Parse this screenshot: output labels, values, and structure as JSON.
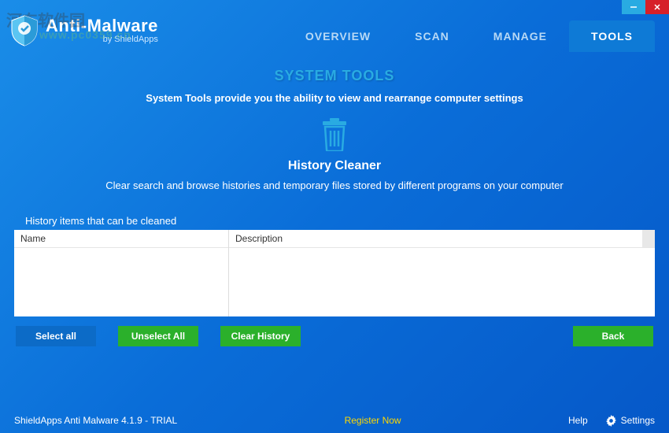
{
  "brand": {
    "title": "Anti-Malware",
    "subtitle": "by ShieldApps"
  },
  "watermark": {
    "line1": "河东软件园",
    "line2": "www.pc0359.cn"
  },
  "nav": {
    "items": [
      {
        "label": "OVERVIEW"
      },
      {
        "label": "SCAN"
      },
      {
        "label": "MANAGE"
      },
      {
        "label": "TOOLS"
      }
    ],
    "active_index": 3
  },
  "section": {
    "title": "SYSTEM TOOLS",
    "desc": "System Tools provide you the ability to view and rearrange computer settings"
  },
  "tool": {
    "title": "History Cleaner",
    "desc": "Clear search and browse histories and temporary files stored by different programs on your computer"
  },
  "list": {
    "label": "History items that can be cleaned",
    "columns": {
      "name": "Name",
      "description": "Description"
    },
    "rows": []
  },
  "buttons": {
    "select_all": "Select all",
    "unselect_all": "Unselect All",
    "clear_history": "Clear History",
    "back": "Back"
  },
  "footer": {
    "version": "ShieldApps Anti Malware 4.1.9 - TRIAL",
    "register": "Register Now",
    "help": "Help",
    "settings": "Settings"
  }
}
